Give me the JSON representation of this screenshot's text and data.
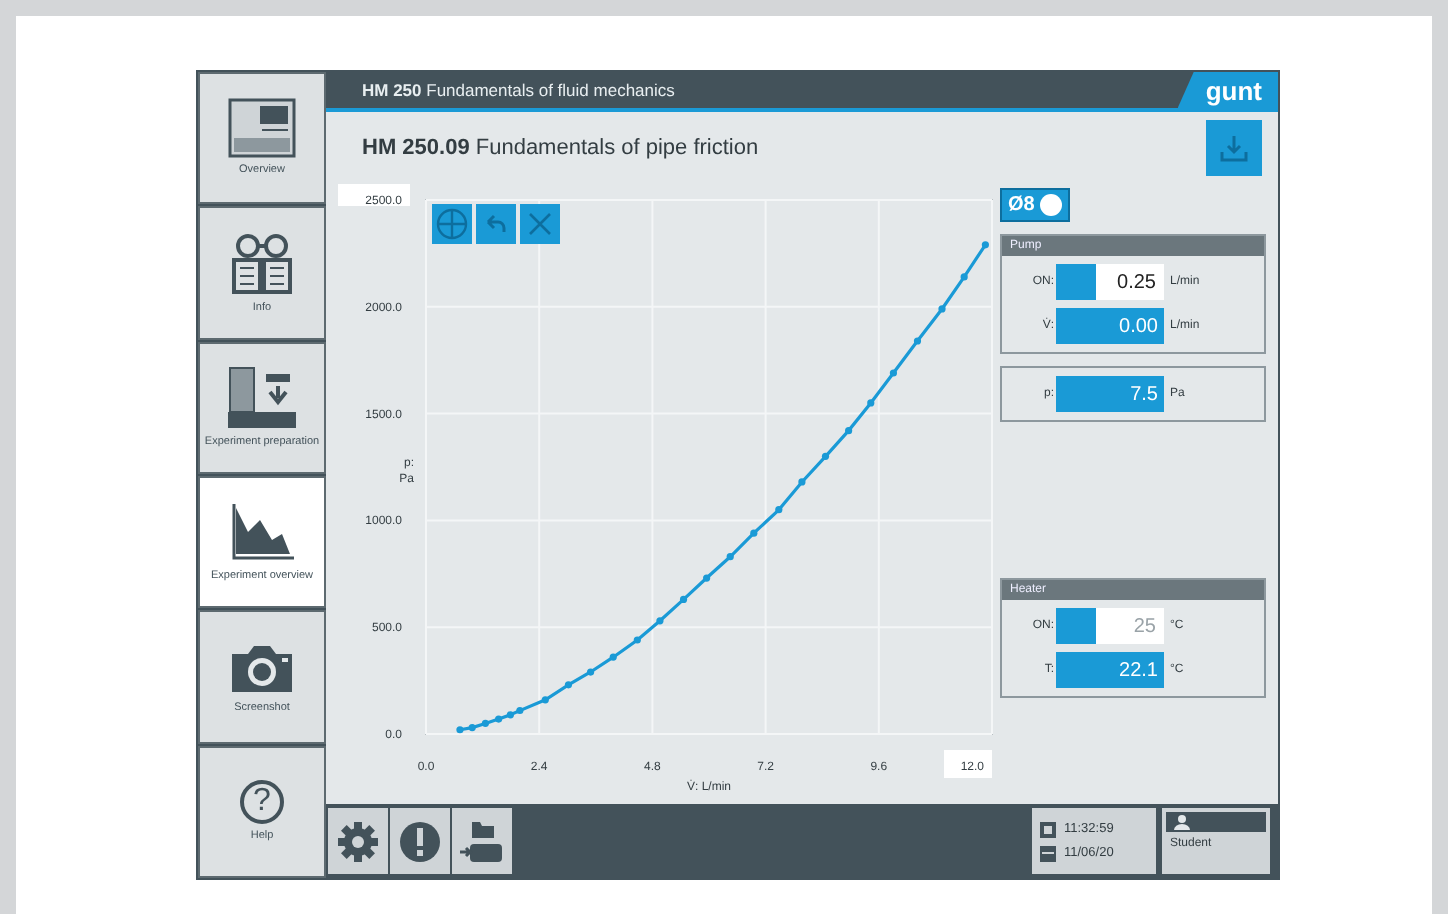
{
  "sidebar": {
    "items": [
      {
        "kind": "overview",
        "label": "Overview",
        "selected": false
      },
      {
        "kind": "info",
        "label": "Info",
        "selected": false
      },
      {
        "kind": "preparation",
        "label": "Experiment preparation",
        "selected": false
      },
      {
        "kind": "chart",
        "label": "Experiment overview",
        "selected": true
      },
      {
        "kind": "camera",
        "label": "Screenshot",
        "selected": false
      },
      {
        "kind": "help",
        "label": "Help",
        "icon": "?",
        "selected": false
      }
    ]
  },
  "header": {
    "code": "HM 250",
    "title": "Fundamentals of fluid mechanics",
    "logo": "gunt"
  },
  "subheader": {
    "code": "HM 250.09",
    "title": "Fundamentals of pipe friction"
  },
  "chart": {
    "chart_data": {
      "type": "line",
      "xlabel": "V̇: L/min",
      "ylabel": "p: Pa",
      "xlim": [
        0,
        12
      ],
      "ylim": [
        0,
        2500
      ],
      "xticks": [
        {
          "value": 0,
          "label": "0.0"
        },
        {
          "value": 2.4,
          "label": "2.4"
        },
        {
          "value": 4.8,
          "label": "4.8"
        },
        {
          "value": 7.2,
          "label": "7.2"
        },
        {
          "value": 9.6,
          "label": "9.6"
        },
        {
          "value": 12,
          "label": "12.0"
        }
      ],
      "yticks": [
        {
          "value": 0,
          "label": "0.0"
        },
        {
          "value": 500,
          "label": "500.0"
        },
        {
          "value": 1000,
          "label": "1000.0"
        },
        {
          "value": 1500,
          "label": "1500.0"
        },
        {
          "value": 2000,
          "label": "2000.0"
        },
        {
          "value": 2500,
          "label": "2500.0"
        }
      ],
      "x": [
        0.72,
        0.98,
        1.26,
        1.54,
        1.79,
        1.99,
        2.53,
        3.02,
        3.49,
        3.97,
        4.48,
        4.96,
        5.46,
        5.95,
        6.45,
        6.95,
        7.48,
        7.97,
        8.47,
        8.96,
        9.43,
        9.91,
        10.42,
        10.94,
        11.41,
        11.86
      ],
      "grid": true,
      "series": [
        {
          "color": "#1a9ad6",
          "marker": true,
          "values": [
            20,
            30,
            50,
            70,
            90,
            110,
            160,
            230,
            290,
            360,
            440,
            530,
            630,
            730,
            830,
            940,
            1050,
            1180,
            1300,
            1420,
            1550,
            1690,
            1840,
            1990,
            2140,
            2290
          ]
        }
      ]
    }
  },
  "pipe_toggle": {
    "label": "Ø8",
    "on": true
  },
  "groups": [
    {
      "title": "Pump",
      "rows": [
        {
          "kind": "setpoint",
          "label": "ON:",
          "on": true,
          "value": "0.25",
          "unit": "L/min",
          "disabled": false
        },
        {
          "kind": "reading",
          "label": "V̇:",
          "value": "0.00",
          "unit": "L/min"
        }
      ]
    },
    {
      "rows": [
        {
          "kind": "reading",
          "label": "p:",
          "value": "7.5",
          "unit": "Pa"
        }
      ]
    },
    {
      "title": "Heater",
      "rows": [
        {
          "kind": "setpoint",
          "label": "ON:",
          "on": true,
          "value": "25",
          "unit": "°C",
          "disabled": true
        },
        {
          "kind": "reading",
          "label": "T:",
          "value": "22.1",
          "unit": "°C"
        }
      ]
    }
  ],
  "status": {
    "time": "11:32:59",
    "date": "11/06/20",
    "user": "Student"
  }
}
